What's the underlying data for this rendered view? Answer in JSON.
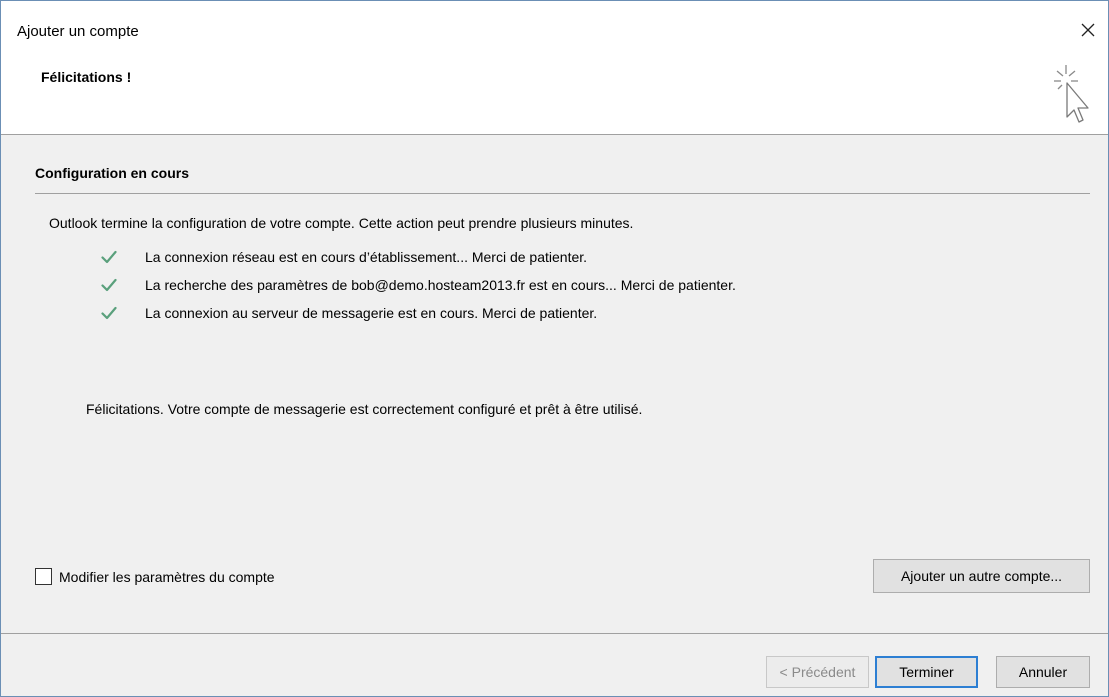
{
  "window": {
    "title": "Ajouter un compte"
  },
  "header": {
    "title": "Félicitations !",
    "icon": "sparkle-cursor-icon"
  },
  "section": {
    "title": "Configuration en cours",
    "intro": "Outlook termine la configuration de votre compte. Cette action peut prendre plusieurs minutes.",
    "steps": [
      {
        "text": "La connexion réseau est en cours d’établissement... Merci de patienter.",
        "status": "done"
      },
      {
        "text": "La recherche des paramètres de bob@demo.hosteam2013.fr est en cours... Merci de patienter.",
        "status": "done"
      },
      {
        "text": "La connexion au serveur de messagerie est en cours. Merci de patienter.",
        "status": "done"
      }
    ],
    "success_message": "Félicitations. Votre compte de messagerie est correctement configuré et prêt à être utilisé."
  },
  "options": {
    "modify_settings_label": "Modifier les paramètres du compte",
    "modify_settings_checked": false,
    "add_another_label": "Ajouter un autre compte..."
  },
  "footer": {
    "prev_label": "< Précédent",
    "finish_label": "Terminer",
    "cancel_label": "Annuler"
  },
  "colors": {
    "check": "#5aa07c",
    "focus_border": "#2d7fd3"
  }
}
